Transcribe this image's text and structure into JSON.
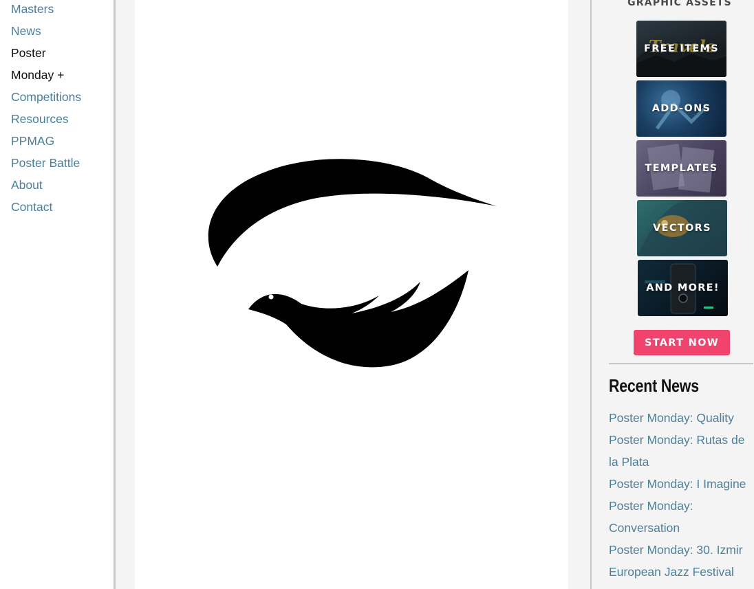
{
  "left_nav": {
    "items": [
      {
        "label": "Masters"
      },
      {
        "label": "News"
      },
      {
        "label": "Poster"
      },
      {
        "label": "Monday +"
      },
      {
        "label": "Competitions"
      },
      {
        "label": "Resources"
      },
      {
        "label": "PPMAG"
      },
      {
        "label": "Poster Battle"
      },
      {
        "label": "About"
      },
      {
        "label": "Contact"
      }
    ]
  },
  "sidebar": {
    "assets_title": "GRAPHIC ASSETS",
    "tiles": [
      {
        "label": "FREE ITEMS",
        "overlay_text": "Travels"
      },
      {
        "label": "ADD-ONS"
      },
      {
        "label": "TEMPLATES"
      },
      {
        "label": "VECTORS"
      },
      {
        "label": "AND MORE!"
      }
    ],
    "start_button": "START NOW",
    "recent_title": "Recent News",
    "news": [
      "Poster Monday: Quality",
      "Poster Monday: Rutas de la Plata",
      "Poster Monday: I Imagine",
      "Poster Monday: Conversation",
      "Poster Monday: 30. Izmir European Jazz Festival"
    ]
  },
  "colors": {
    "link": "#4d7f99",
    "accent_button": "#f0446e",
    "page_bg": "#f4f4f4"
  }
}
